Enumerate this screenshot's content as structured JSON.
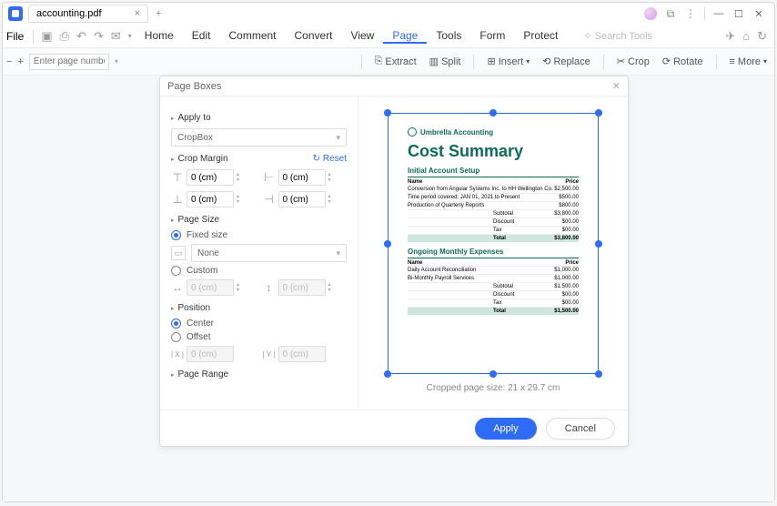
{
  "titlebar": {
    "filename": "accounting.pdf",
    "close": "×",
    "plus": "+"
  },
  "window": {
    "min": "—",
    "max": "☐",
    "close": "✕",
    "more": "⋮"
  },
  "menubar": {
    "file": "File",
    "tabs": [
      "Home",
      "Edit",
      "Comment",
      "Convert",
      "View",
      "Page",
      "Tools",
      "Form",
      "Protect"
    ],
    "active": "Page",
    "search_placeholder": "Search Tools"
  },
  "toolbar": {
    "minus": "−",
    "plus": "+",
    "page_placeholder": "Enter page number",
    "extract": "Extract",
    "split": "Split",
    "insert": "Insert",
    "replace": "Replace",
    "crop": "Crop",
    "rotate": "Rotate",
    "more": "More"
  },
  "dialog": {
    "title": "Page Boxes",
    "sections": {
      "apply_to": "Apply to",
      "crop_margin": "Crop Margin",
      "page_size": "Page Size",
      "position": "Position",
      "page_range": "Page Range"
    },
    "apply_to_value": "CropBox",
    "reset": "Reset",
    "margin_top": "0 (cm)",
    "margin_left": "0 (cm)",
    "margin_bottom": "0 (cm)",
    "margin_right": "0 (cm)",
    "page_size": {
      "fixed": "Fixed size",
      "none": "None",
      "custom": "Custom",
      "w": "0 (cm)",
      "h": "0 (cm)"
    },
    "position": {
      "center": "Center",
      "offset": "Offset",
      "x_label": "| X |",
      "y_label": "| Y |",
      "x": "0 (cm)",
      "y": "0 (cm)"
    },
    "preview_size": "Cropped page size: 21 x 29.7 cm",
    "apply": "Apply",
    "cancel": "Cancel"
  },
  "preview": {
    "brand": "Umbrella Accounting",
    "title": "Cost Summary",
    "section1": "Initial Account Setup",
    "header_name": "Name",
    "header_price": "Price",
    "rows1": [
      {
        "name": "Conversion from Angular Systems Inc. to HH Wellington Co.",
        "price": "$2,500.00"
      },
      {
        "name": "Time period covered: JAN 01, 2021 to Present",
        "price": "$500.00"
      },
      {
        "name": "Production of Quarterly Reports",
        "price": "$800.00"
      }
    ],
    "summary1": [
      {
        "label": "Subtotal",
        "value": "$3,800.00"
      },
      {
        "label": "Discount",
        "value": "$00.00"
      },
      {
        "label": "Tax",
        "value": "$00.00"
      },
      {
        "label": "Total",
        "value": "$3,800.00"
      }
    ],
    "section2": "Ongoing Monthly Expenses",
    "rows2": [
      {
        "name": "Daily Account Reconciliation",
        "price": "$1,000.00"
      },
      {
        "name": "Bi-Monthly Payroll Services",
        "price": "$1,000.00"
      }
    ],
    "summary2": [
      {
        "label": "Subtotal",
        "value": "$1,500.00"
      },
      {
        "label": "Discount",
        "value": "$00.00"
      },
      {
        "label": "Tax",
        "value": "$00.00"
      },
      {
        "label": "Total",
        "value": "$1,500.00"
      }
    ]
  }
}
